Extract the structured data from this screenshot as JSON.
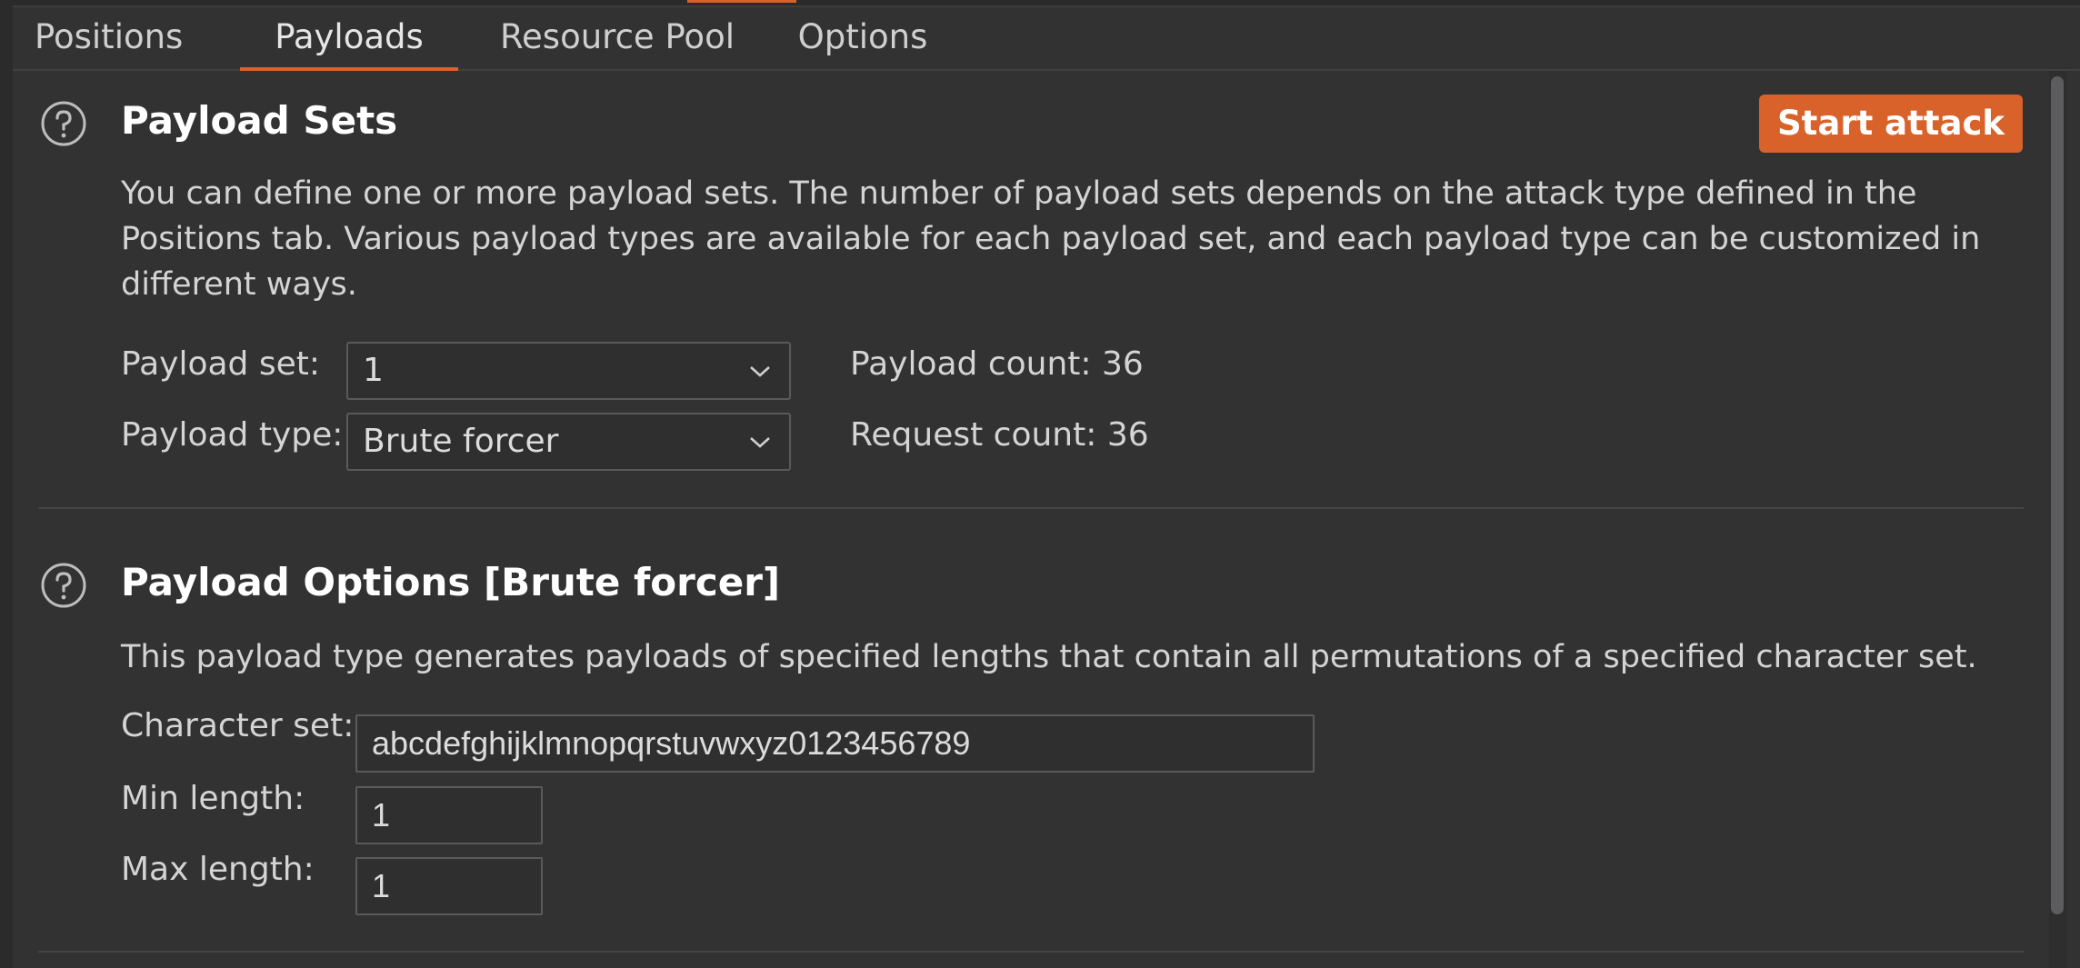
{
  "tabs": [
    {
      "label": "Positions",
      "active": false
    },
    {
      "label": "Payloads",
      "active": true
    },
    {
      "label": "Resource Pool",
      "active": false
    },
    {
      "label": "Options",
      "active": false
    }
  ],
  "payload_sets": {
    "title": "Payload Sets",
    "start_attack_label": "Start attack",
    "description": "You can define one or more payload sets. The number of payload sets depends on the attack type defined in the Positions tab. Various payload types are available for each payload set, and each payload type can be customized in different ways.",
    "description_lines": [
      "You can define one or more payload sets. The number of payload sets depends on the attack type defined in the",
      "Positions tab. Various payload types are available for each payload set, and each payload type can be customized in",
      "different ways."
    ],
    "payload_set_label": "Payload set:",
    "payload_set_value": "1",
    "payload_type_label": "Payload type:",
    "payload_type_value": "Brute forcer",
    "payload_count_label": "Payload count:",
    "payload_count_value": "36",
    "request_count_label": "Request count:",
    "request_count_value": "36"
  },
  "payload_options": {
    "title": "Payload Options [Brute forcer]",
    "description": "This payload type generates payloads of specified lengths that contain all permutations of a specified character set.",
    "character_set_label": "Character set:",
    "character_set_value": "abcdefghijklmnopqrstuvwxyz0123456789",
    "min_length_label": "Min length:",
    "min_length_value": "1",
    "max_length_label": "Max length:",
    "max_length_value": "1"
  },
  "colors": {
    "accent": "#d9622b",
    "background": "#323233",
    "text": "#d4d4d4"
  },
  "icons": [
    "help-icon",
    "chevron-down-icon"
  ]
}
